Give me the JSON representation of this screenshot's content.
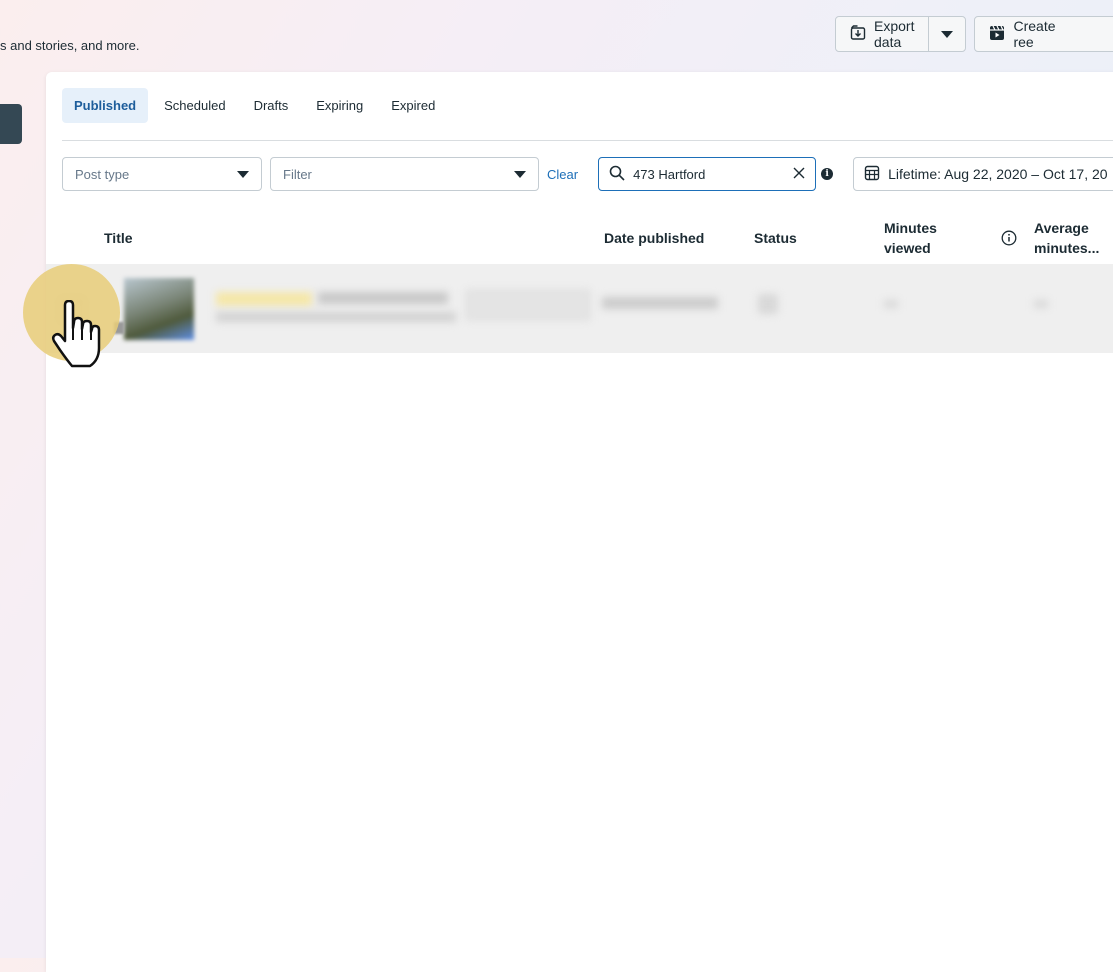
{
  "header": {
    "subtitle": "s and stories, and more.",
    "export_label": "Export data",
    "create_label": "Create ree"
  },
  "tabs": [
    {
      "label": "Published",
      "active": true
    },
    {
      "label": "Scheduled",
      "active": false
    },
    {
      "label": "Drafts",
      "active": false
    },
    {
      "label": "Expiring",
      "active": false
    },
    {
      "label": "Expired",
      "active": false
    }
  ],
  "filters": {
    "post_type_placeholder": "Post type",
    "filter_placeholder": "Filter",
    "clear_label": "Clear",
    "search_value": "473 Hartford",
    "info_glyph": "i",
    "date_range_label": "Lifetime: Aug 22, 2020 – Oct 17, 20"
  },
  "table": {
    "columns": {
      "title": "Title",
      "date_published": "Date published",
      "status": "Status",
      "minutes_viewed_1": "Minutes",
      "minutes_viewed_2": "viewed",
      "avg_minutes_1": "Average",
      "avg_minutes_2": "minutes..."
    }
  },
  "colors": {
    "accent": "#1d6fb8",
    "active_tab_bg": "#e6f0fa",
    "cursor_halo": "#e8cd78"
  },
  "icons": [
    "export-icon",
    "chevron-down-icon",
    "clapperboard-icon",
    "search-icon",
    "close-icon",
    "info-icon",
    "calendar-icon",
    "pointer-hand-icon"
  ]
}
